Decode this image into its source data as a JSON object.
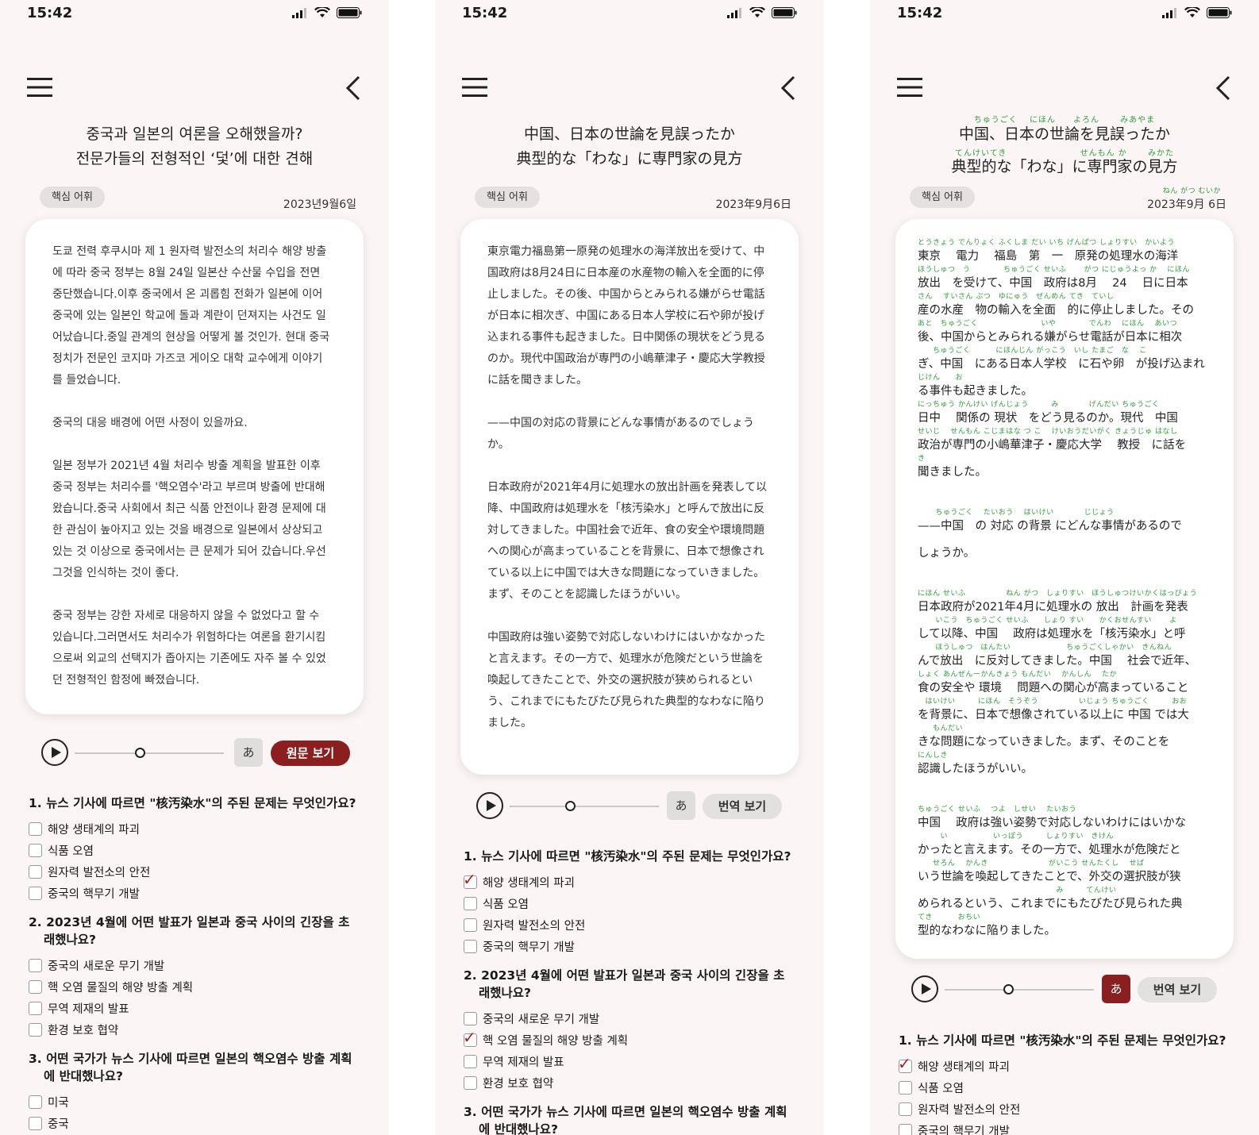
{
  "status": {
    "time": "15:42"
  },
  "tag_label": "핵심 어휘",
  "screen1": {
    "title_line1": "중국과 일본의 여론을 오해했을까?",
    "title_line2": "전문가들의 전형적인 ‘덫’에 대한 견해",
    "date": "2023년9월6일",
    "paragraphs": [
      "도쿄 전력 후쿠시마 제 1 원자력 발전소의 처리수 해양 방출에 따라 중국 정부는 8월 24일 일본산 수산물 수입을 전면 중단했습니다.이후 중국에서 온 괴롭힘 전화가 일본에 이어 중국에 있는 일본인 학교에 돌과 계란이 던져지는 사건도 일어났습니다.중일 관계의 현상을 어떻게 볼 것인가. 현대 중국 정치가 전문인 코지마 가즈코 게이오 대학 교수에게 이야기를 들었습니다.",
      "중국의 대응 배경에 어떤 사정이 있을까요.",
      "일본 정부가 2021년 4월 처리수 방출 계획을 발표한 이후 중국 정부는 처리수를 '핵오염수'라고 부르며 방출에 반대해 왔습니다.중국 사회에서 최근 식품 안전이나 환경 문제에 대한 관심이 높아지고 있는 것을 배경으로 일본에서 상상되고 있는 것 이상으로 중국에서는 큰 문제가 되어 갔습니다.우선 그것을 인식하는 것이 좋다.",
      "중국 정부는 강한 자세로 대응하지 않을 수 없었다고 할 수 있습니다.그러면서도 처리수가 위험하다는 여론을 환기시킴으로써 외교의 선택지가 좁아지는 기존에도 자주 볼 수 있었던 전형적인 함정에 빠졌습니다."
    ],
    "kana_label": "あ",
    "toggle_label": "원문 보기",
    "progress": 0.44
  },
  "screen2": {
    "title_line1": "中国、日本の世論を見誤ったか",
    "title_line2": "典型的な「わな」に専門家の見方",
    "date": "2023年9月6日",
    "paragraphs": [
      "東京電力福島第一原発の処理水の海洋放出を受けて、中国政府は8月24日に日本産の水産物の輸入を全面的に停止しました。その後、中国からとみられる嫌がらせ電話が日本に相次ぎ、中国にある日本人学校に石や卵が投げ込まれる事件も起きました。日中関係の現状をどう見るのか。現代中国政治が専門の小嶋華津子・慶応大学教授に話を聞きました。",
      "——中国の対応の背景にどんな事情があるのでしょうか。",
      "日本政府が2021年4月に処理水の放出計画を発表して以降、中国政府は処理水を「核汚染水」と呼んで放出に反対してきました。中国社会で近年、食の安全や環境問題への関心が高まっていることを背景に、日本で想像されている以上に中国では大きな問題になっていきました。まず、そのことを認識したほうがいい。",
      "中国政府は強い姿勢で対応しないわけにはいかなかったと言えます。その一方で、処理水が危険だという世論を喚起してきたことで、外交の選択肢が狭められるという、これまでにもたびたび見られた典型的なわなに陥りました。"
    ],
    "kana_label": "あ",
    "toggle_label": "번역 보기",
    "progress": 0.44
  },
  "screen3": {
    "title_ruby1": "ちゅうごく　 にほん　　よろん　　 みあやま",
    "title_line1": "中国、日本の世論を見誤ったか",
    "title_ruby2": "てんけいてき　　　　　　　　 せんもん か　　 みかた",
    "title_line2": "典型的な「わな」に専門家の見方",
    "date_ruby": "ねん がつ むいか",
    "date": "2023年9月 6日",
    "lines": [
      {
        "ruby": "とうきょう でんりょく ふくしま だい いち げんぱつ しょりすい　かいよう",
        "text": "東京　 電力　 福島　第　一　原発の処理水の海洋"
      },
      {
        "ruby": "ほうしゅつ　う　　　　 ちゅうごく せいふ　　 がつ にじゅうよっ か　 にほん",
        "text": "放出　を受けて、中国　政府は8月　 24　 日に日本"
      },
      {
        "ruby": "さん　 すいさん ぶつ　ゆにゅう　ぜんめん てき　ていし",
        "text": "産の水産　物の輸入を全面　的に停止しました。その"
      },
      {
        "ruby": "あと　ちゅうごく　　　　　　　　 いや　　　　 でんわ　 にほん　 あいつ",
        "text": "後、中国からとみられる嫌がらせ電話が日本に相次"
      },
      {
        "ruby": "　　ちゅうごく　　　 にほんじん がっこう　いし たまご　な　 こ",
        "text": "ぎ、中国　にある日本人学校　に石や卵　が投げ込まれ"
      },
      {
        "ruby": "じけん　　お",
        "text": "る事件も起きました。"
      },
      {
        "ruby": "にっちゅう かんけい げんじょう　　　み　　　　げんだい ちゅうごく",
        "text": "日中　 関係の 現状　をどう見るのか。現代　中国"
      },
      {
        "ruby": "せいじ　 せんもん こじまはな つ こ　 けいおうだいがく きょうじゅ はなし",
        "text": "政治が専門の小嶋華津子・慶応大学　 教授　に話を"
      },
      {
        "ruby": "き",
        "text": "聞きました。"
      },
      {
        "ruby": "",
        "text": ""
      },
      {
        "ruby": "　　 ちゅうごく　 たいおう　 はいけい　　　　じじょう",
        "text": "——中国　の 対応 の背景 にどんな事情があるので"
      },
      {
        "ruby": "",
        "text": "しょうか。"
      },
      {
        "ruby": "",
        "text": ""
      },
      {
        "ruby": "にほん せいふ　　　　　 ねん がつ　しょりすい　ほうしゅつけいかくはっぴょう",
        "text": "日本政府が2021年4月に処理水の 放出　計画を発表"
      },
      {
        "ruby": "　　 いこう　ちゅうごく せいふ　　しょり すい　　かくおせんすい　　 よ",
        "text": "して以降、中国　 政府は処理水を「核汚染水」と呼"
      },
      {
        "ruby": "　　 ほうしゅつ　はんたい　　　　　　　 ちゅうごくしゃかい　きんねん",
        "text": "んで放出　に反対してきました。中国　 社会で近年、"
      },
      {
        "ruby": "しょく あんぜんーかんきょう もんだい　 かんしん　 たか",
        "text": "食の安全や 環境　 問題への関心が高まっていること"
      },
      {
        "ruby": "　はいけい　　　にほん　そうぞう　　　　　 いじょう ちゅうごく　　　おお",
        "text": "を背景に、日本で想像されている以上に 中国 では大"
      },
      {
        "ruby": "　　もんだい",
        "text": "きな問題になっていきました。まず、そのことを"
      },
      {
        "ruby": "にんしき",
        "text": "認識したほうがいい。"
      },
      {
        "ruby": "",
        "text": ""
      },
      {
        "ruby": "ちゅうごく せいふ　 つよ　しせい　 たいおう",
        "text": "中国　 政府は強い姿勢で対応しないわけにはいかな"
      },
      {
        "ruby": "　　　い　　　　　　いっぽう　　　しょりすい　きけん",
        "text": "かったと言えます。その一方で、処理水が危険だと"
      },
      {
        "ruby": "　　せろん　 かんき　　　　　　　　がいこう せんたくし　 せば",
        "text": "いう世論を喚起してきたことで、外交の選択肢が狭"
      },
      {
        "ruby": "　　　　　　　　　　　　　　　　　　 み　　　てんけい",
        "text": "められるという、これまでにもたびたび見られた典"
      },
      {
        "ruby": "てき　　　 おちい",
        "text": "型的なわなに陥りました。"
      }
    ],
    "kana_label": "あ",
    "toggle_label": "번역 보기",
    "progress": 0.44
  },
  "quiz": [
    {
      "question": "1. 뉴스 기사에 따르면 \"核汚染水\"의 주된 문제는 무엇인가요?",
      "options": [
        "해양 생태계의 파괴",
        "식품 오염",
        "원자력 발전소의 안전",
        "중국의 핵무기 개발"
      ]
    },
    {
      "question": "2. 2023년 4월에 어떤 발표가 일본과 중국 사이의 긴장을 초래했나요?",
      "options": [
        "중국의 새로운 무기 개발",
        "핵 오염 물질의 해양 방출 계획",
        "무역 제재의 발표",
        "환경 보호 협약"
      ]
    },
    {
      "question": "3. 어떤 국가가 뉴스 기사에 따르면 일본의 핵오염수 방출 계획에 반대했나요?",
      "options": [
        "미국",
        "중국"
      ]
    }
  ],
  "colors": {
    "accent": "#8b1e1e",
    "ruby": "#2e9e3a",
    "background": "#fbf5f5"
  },
  "icons": [
    "menu-icon",
    "back-icon",
    "play-icon",
    "signal-icon",
    "wifi-icon",
    "battery-icon"
  ]
}
